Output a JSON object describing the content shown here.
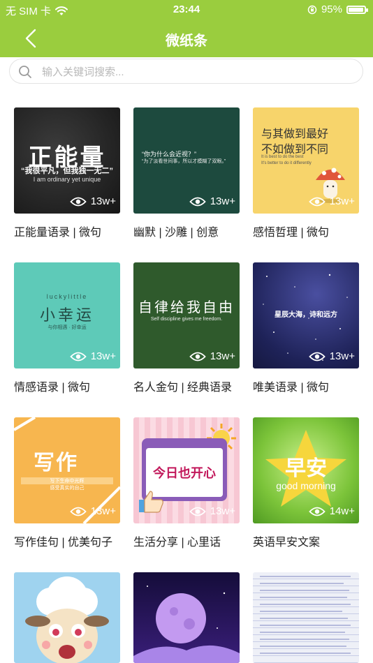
{
  "status": {
    "carrier": "无 SIM 卡",
    "time": "23:44",
    "battery": "95%",
    "battery_level": 0.95
  },
  "header": {
    "title": "微纸条"
  },
  "search": {
    "placeholder": "输入关键词搜索..."
  },
  "colors": {
    "accent": "#9acd3e"
  },
  "cards": [
    {
      "title": "正能量语录 | 微句",
      "views": "13w+",
      "thumb": {
        "main": "正能量",
        "line1": "“我很平凡，但我独一无二”",
        "line2": "I am ordinary yet unique"
      }
    },
    {
      "title": "幽默 | 沙雕 | 创意",
      "views": "13w+",
      "thumb": {
        "line1": "“你为什么会近视？”",
        "line2": "“为了淡看世间事，所以才模糊了双眼。”"
      }
    },
    {
      "title": "感悟哲理 | 微句",
      "views": "13w+",
      "thumb": {
        "line1": "与其做到最好",
        "line2": "不如做到不同",
        "line3": "It is best to do the best",
        "line4": "It's better to do it differently"
      }
    },
    {
      "title": "情感语录 | 微句",
      "views": "13w+",
      "thumb": {
        "small": "luckylittle",
        "main": "小幸运",
        "sub": "与你相遇 · 好幸运"
      }
    },
    {
      "title": "名人金句 | 经典语录",
      "views": "13w+",
      "thumb": {
        "main": "自律给我自由",
        "sub": "Self discipline gives me freedom."
      }
    },
    {
      "title": "唯美语录 | 微句",
      "views": "13w+",
      "thumb": {
        "main": "星辰大海，诗和远方"
      }
    },
    {
      "title": "写作佳句 | 优美句子",
      "views": "13w+",
      "thumb": {
        "main": "写作",
        "line1": "写下生命中光辉",
        "line2": "感受真实的自己"
      }
    },
    {
      "title": "生活分享 | 心里话",
      "views": "13w+",
      "thumb": {
        "main": "今日也开心"
      }
    },
    {
      "title": "英语早安文案",
      "views": "14w+",
      "thumb": {
        "main": "早安",
        "sub": "good morning"
      }
    }
  ]
}
